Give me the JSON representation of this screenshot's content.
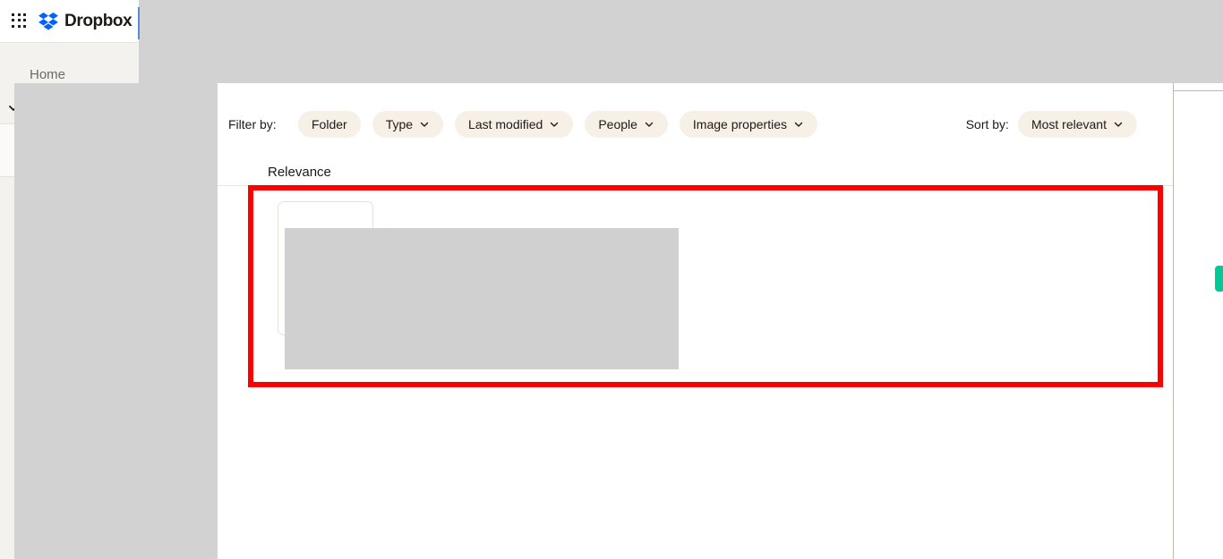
{
  "app": {
    "brand_name": "Dropbox",
    "grid_icon": "apps-grid-icon",
    "logo_icon": "dropbox-logo-icon"
  },
  "sidebar": {
    "items": [
      {
        "label": "Home",
        "icon": "home-icon"
      }
    ],
    "expander_icon": "chevron-down-icon"
  },
  "main": {
    "filter": {
      "label": "Filter by:",
      "pills": [
        {
          "label": "Folder",
          "has_chevron": false,
          "icon": "chevron-down-icon"
        },
        {
          "label": "Type",
          "has_chevron": true,
          "icon": "chevron-down-icon"
        },
        {
          "label": "Last modified",
          "has_chevron": true,
          "icon": "chevron-down-icon"
        },
        {
          "label": "People",
          "has_chevron": true,
          "icon": "chevron-down-icon"
        },
        {
          "label": "Image properties",
          "has_chevron": true,
          "icon": "chevron-down-icon"
        }
      ]
    },
    "sort": {
      "label": "Sort by:",
      "value": "Most relevant",
      "icon": "chevron-down-icon"
    },
    "section_heading": "Relevance"
  },
  "colors": {
    "brand_blue": "#0061ff",
    "pill_bg": "#f7f0e7",
    "sidebar_bg": "#f4f2ee",
    "highlight_red": "#fb0101",
    "accent_green": "#00c896",
    "occluder_gray": "#d2d2d2"
  }
}
